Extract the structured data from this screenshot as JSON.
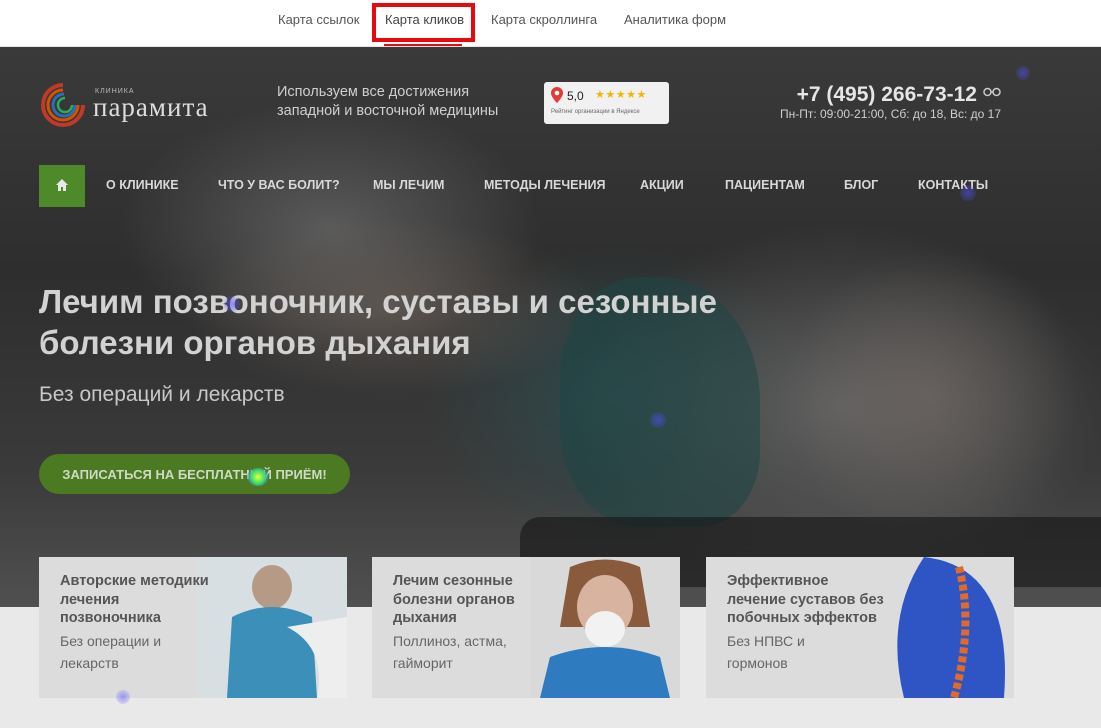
{
  "tabs": [
    {
      "label": "Карта ссылок"
    },
    {
      "label": "Карта кликов"
    },
    {
      "label": "Карта скроллинга"
    },
    {
      "label": "Аналитика форм"
    }
  ],
  "logo": {
    "small": "клиника",
    "name": "парамита"
  },
  "tagline": "Используем все достижения западной и восточной медицины",
  "rating": {
    "score": "5,0",
    "stars": "★★★★★",
    "caption": "Рейтинг организации в Яндексе"
  },
  "contact": {
    "phone": "+7 (495) 266-73-12",
    "hours": "Пн-Пт: 09:00-21:00, Сб: до 18, Вс: до 17"
  },
  "nav": [
    {
      "label": "О клинике"
    },
    {
      "label": "Что у вас болит?"
    },
    {
      "label": "Мы лечим"
    },
    {
      "label": "Методы лечения"
    },
    {
      "label": "Акции"
    },
    {
      "label": "Пациентам"
    },
    {
      "label": "Блог"
    },
    {
      "label": "Контакты"
    }
  ],
  "hero": {
    "title": "Лечим позвоночник, суставы и сезонные болезни органов дыхания",
    "subtitle": "Без операций и лекарств",
    "cta": "Записаться на бесплатный приём!"
  },
  "cards": [
    {
      "title": "Авторские методики лечения позвоночника",
      "text": "Без операции и лекарств"
    },
    {
      "title": "Лечим сезонные болезни органов дыхания",
      "text": "Поллиноз, астма, гайморит"
    },
    {
      "title": "Эффективное лечение суставов без побочных эффектов",
      "text": "Без НПВС и гормонов"
    }
  ],
  "colors": {
    "tab_highlight": "#e8090f",
    "accent_green": "#4e8a2a",
    "rating_stars": "#f4b400"
  }
}
